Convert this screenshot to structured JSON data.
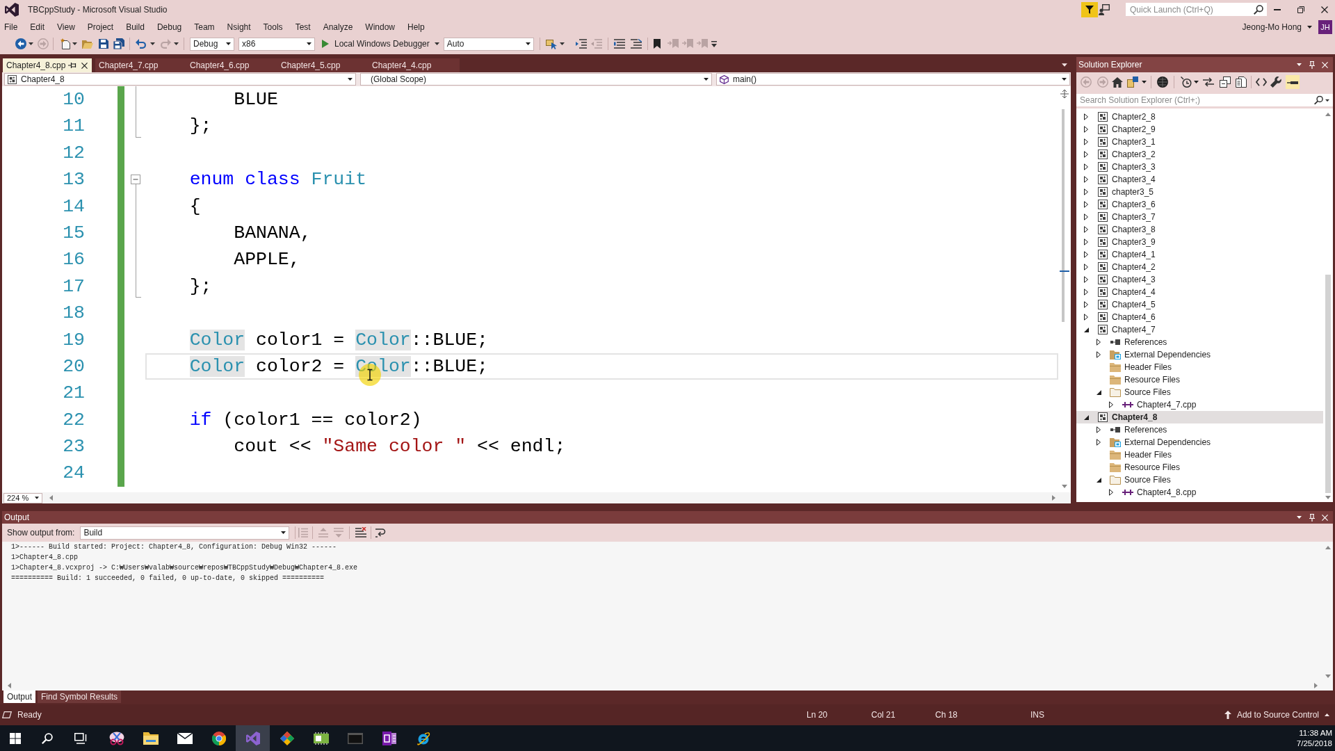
{
  "window": {
    "title": "TBCppStudy - Microsoft Visual Studio",
    "quick_launch": {
      "placeholder": "Quick Launch (Ctrl+Q)"
    }
  },
  "account": {
    "name": "Jeong-Mo Hong",
    "initials": "JH"
  },
  "menu": [
    "File",
    "Edit",
    "View",
    "Project",
    "Build",
    "Debug",
    "Team",
    "Nsight",
    "Tools",
    "Test",
    "Analyze",
    "Window",
    "Help"
  ],
  "toolbar": {
    "configuration": "Debug",
    "platform": "x86",
    "debugger": "Local Windows Debugger",
    "target": "Auto"
  },
  "document_tabs": [
    {
      "label": "Chapter4_8.cpp",
      "selected": true
    },
    {
      "label": "Chapter4_7.cpp",
      "selected": false
    },
    {
      "label": "Chapter4_6.cpp",
      "selected": false
    },
    {
      "label": "Chapter4_5.cpp",
      "selected": false
    },
    {
      "label": "Chapter4_4.cpp",
      "selected": false
    }
  ],
  "navigation_bar": {
    "project": "Chapter4_8",
    "scope": "(Global Scope)",
    "member": "main()"
  },
  "editor": {
    "lines": [
      {
        "number": "10",
        "kind": "inside",
        "changed": true,
        "current": false,
        "tokens": [
          {
            "text": "        BLUE",
            "kind": "plain",
            "highlighted": false
          }
        ]
      },
      {
        "number": "11",
        "kind": "end",
        "changed": true,
        "current": false,
        "tokens": [
          {
            "text": "    };",
            "kind": "plain",
            "highlighted": false
          }
        ]
      },
      {
        "number": "12",
        "kind": "plain",
        "changed": true,
        "current": false
      },
      {
        "number": "13",
        "kind": "start",
        "changed": true,
        "current": false,
        "tokens": [
          {
            "text": "    enum class",
            "kind": "keyword",
            "highlighted": false
          },
          {
            "text": " Fruit",
            "kind": "type",
            "highlighted": false
          }
        ]
      },
      {
        "number": "14",
        "kind": "inside",
        "changed": true,
        "current": false,
        "tokens": [
          {
            "text": "    {",
            "kind": "plain",
            "highlighted": false
          }
        ]
      },
      {
        "number": "15",
        "kind": "inside",
        "changed": true,
        "current": false,
        "tokens": [
          {
            "text": "        BANANA,",
            "kind": "plain",
            "highlighted": false
          }
        ]
      },
      {
        "number": "16",
        "kind": "inside",
        "changed": true,
        "current": false,
        "tokens": [
          {
            "text": "        APPLE,",
            "kind": "plain",
            "highlighted": false
          }
        ]
      },
      {
        "number": "17",
        "kind": "end",
        "changed": true,
        "current": false,
        "tokens": [
          {
            "text": "    };",
            "kind": "plain",
            "highlighted": false
          }
        ]
      },
      {
        "number": "18",
        "kind": "plain",
        "changed": true,
        "current": false
      },
      {
        "number": "19",
        "kind": "plain",
        "changed": true,
        "current": false,
        "tokens": [
          {
            "text": "    Color",
            "kind": "type",
            "highlighted": true
          },
          {
            "text": " color1 = ",
            "kind": "plain",
            "highlighted": false
          },
          {
            "text": "Color",
            "kind": "type",
            "highlighted": true
          },
          {
            "text": "::BLUE;",
            "kind": "plain",
            "highlighted": false
          }
        ]
      },
      {
        "number": "20",
        "kind": "plain",
        "changed": true,
        "current": true,
        "tokens": [
          {
            "text": "    Color",
            "kind": "type",
            "highlighted": true
          },
          {
            "text": " color2 = ",
            "kind": "plain",
            "highlighted": false
          },
          {
            "text": "Color",
            "kind": "type",
            "highlighted": true
          },
          {
            "text": "::BLUE;",
            "kind": "plain",
            "highlighted": false
          }
        ]
      },
      {
        "number": "21",
        "kind": "plain",
        "changed": true,
        "current": false
      },
      {
        "number": "22",
        "kind": "plain",
        "changed": true,
        "current": false,
        "tokens": [
          {
            "text": "    if",
            "kind": "keyword",
            "highlighted": false
          },
          {
            "text": " (color1 == color2)",
            "kind": "plain",
            "highlighted": false
          }
        ]
      },
      {
        "number": "23",
        "kind": "plain",
        "changed": true,
        "current": false,
        "tokens": [
          {
            "text": "        cout << ",
            "kind": "plain",
            "highlighted": false
          },
          {
            "text": "\"Same color \"",
            "kind": "string",
            "highlighted": false
          },
          {
            "text": " << endl;",
            "kind": "plain",
            "highlighted": false
          }
        ]
      },
      {
        "number": "24",
        "kind": "plain",
        "changed": true,
        "current": false
      }
    ],
    "zoom": "224 %"
  },
  "solution_explorer": {
    "title": "Solution Explorer",
    "search": {
      "placeholder": "Search Solution Explorer (Ctrl+;)"
    },
    "items": [
      {
        "label": "Chapter2_8",
        "kind": "project",
        "expanded": false,
        "selected": false,
        "startup": false
      },
      {
        "label": "Chapter2_9",
        "kind": "project",
        "expanded": false,
        "selected": false,
        "startup": false
      },
      {
        "label": "Chapter3_1",
        "kind": "project",
        "expanded": false,
        "selected": false,
        "startup": false
      },
      {
        "label": "Chapter3_2",
        "kind": "project",
        "expanded": false,
        "selected": false,
        "startup": false
      },
      {
        "label": "Chapter3_3",
        "kind": "project",
        "expanded": false,
        "selected": false,
        "startup": false
      },
      {
        "label": "Chapter3_4",
        "kind": "project",
        "expanded": false,
        "selected": false,
        "startup": false
      },
      {
        "label": "chapter3_5",
        "kind": "project",
        "expanded": false,
        "selected": false,
        "startup": false
      },
      {
        "label": "Chapter3_6",
        "kind": "project",
        "expanded": false,
        "selected": false,
        "startup": false
      },
      {
        "label": "Chapter3_7",
        "kind": "project",
        "expanded": false,
        "selected": false,
        "startup": false
      },
      {
        "label": "Chapter3_8",
        "kind": "project",
        "expanded": false,
        "selected": false,
        "startup": false
      },
      {
        "label": "Chapter3_9",
        "kind": "project",
        "expanded": false,
        "selected": false,
        "startup": false
      },
      {
        "label": "Chapter4_1",
        "kind": "project",
        "expanded": false,
        "selected": false,
        "startup": false
      },
      {
        "label": "Chapter4_2",
        "kind": "project",
        "expanded": false,
        "selected": false,
        "startup": false
      },
      {
        "label": "Chapter4_3",
        "kind": "project",
        "expanded": false,
        "selected": false,
        "startup": false
      },
      {
        "label": "Chapter4_4",
        "kind": "project",
        "expanded": false,
        "selected": false,
        "startup": false
      },
      {
        "label": "Chapter4_5",
        "kind": "project",
        "expanded": false,
        "selected": false,
        "startup": false
      },
      {
        "label": "Chapter4_6",
        "kind": "project",
        "expanded": false,
        "selected": false,
        "startup": false
      },
      {
        "label": "Chapter4_7",
        "kind": "project",
        "expanded": true,
        "selected": false,
        "startup": false,
        "children": [
          {
            "label": "References",
            "kind": "references",
            "expanded": false,
            "selected": false
          },
          {
            "label": "External Dependencies",
            "kind": "dependencies",
            "expanded": false,
            "selected": false
          },
          {
            "label": "Header Files",
            "kind": "filter",
            "selected": false
          },
          {
            "label": "Resource Files",
            "kind": "filter",
            "selected": false
          },
          {
            "label": "Source Files",
            "kind": "filter",
            "expanded": true,
            "selected": false,
            "children": [
              {
                "label": "Chapter4_7.cpp",
                "kind": "cpp",
                "expanded": false,
                "selected": false
              }
            ]
          }
        ]
      },
      {
        "label": "Chapter4_8",
        "kind": "project",
        "expanded": true,
        "selected": true,
        "startup": true,
        "children": [
          {
            "label": "References",
            "kind": "references",
            "expanded": false,
            "selected": false
          },
          {
            "label": "External Dependencies",
            "kind": "dependencies",
            "expanded": false,
            "selected": false
          },
          {
            "label": "Header Files",
            "kind": "filter",
            "selected": false
          },
          {
            "label": "Resource Files",
            "kind": "filter",
            "selected": false
          },
          {
            "label": "Source Files",
            "kind": "filter",
            "expanded": true,
            "selected": false,
            "children": [
              {
                "label": "Chapter4_8.cpp",
                "kind": "cpp",
                "expanded": false,
                "selected": false
              }
            ]
          }
        ]
      }
    ]
  },
  "output": {
    "title": "Output",
    "source_label": "Show output from:",
    "source": "Build",
    "lines": [
      "1>------ Build started: Project: Chapter4_8, Configuration: Debug Win32 ------",
      "1>Chapter4_8.cpp",
      "1>Chapter4_8.vcxproj -> C:₩Users₩valab₩source₩repos₩TBCppStudy₩Debug₩Chapter4_8.exe",
      "========== Build: 1 succeeded, 0 failed, 0 up-to-date, 0 skipped =========="
    ]
  },
  "bottom_tabs": [
    {
      "label": "Output",
      "selected": true
    },
    {
      "label": "Find Symbol Results",
      "selected": false
    }
  ],
  "status_bar": {
    "message": "Ready",
    "line": "Ln 20",
    "column": "Col 21",
    "char": "Ch 18",
    "mode": "INS",
    "source_control": "Add to Source Control"
  },
  "taskbar": {
    "apps": [
      {
        "kind": "scissors",
        "selected": false
      },
      {
        "kind": "folder",
        "selected": false
      },
      {
        "kind": "mail",
        "selected": false
      },
      {
        "kind": "browser",
        "selected": false
      },
      {
        "kind": "studio",
        "selected": true
      },
      {
        "kind": "diamond",
        "selected": false
      },
      {
        "kind": "card",
        "selected": false
      },
      {
        "kind": "terminal",
        "selected": false
      },
      {
        "kind": "notebook",
        "selected": false
      },
      {
        "kind": "globe",
        "selected": false
      }
    ],
    "time": "11:38 AM",
    "date": "7/25/2018"
  }
}
